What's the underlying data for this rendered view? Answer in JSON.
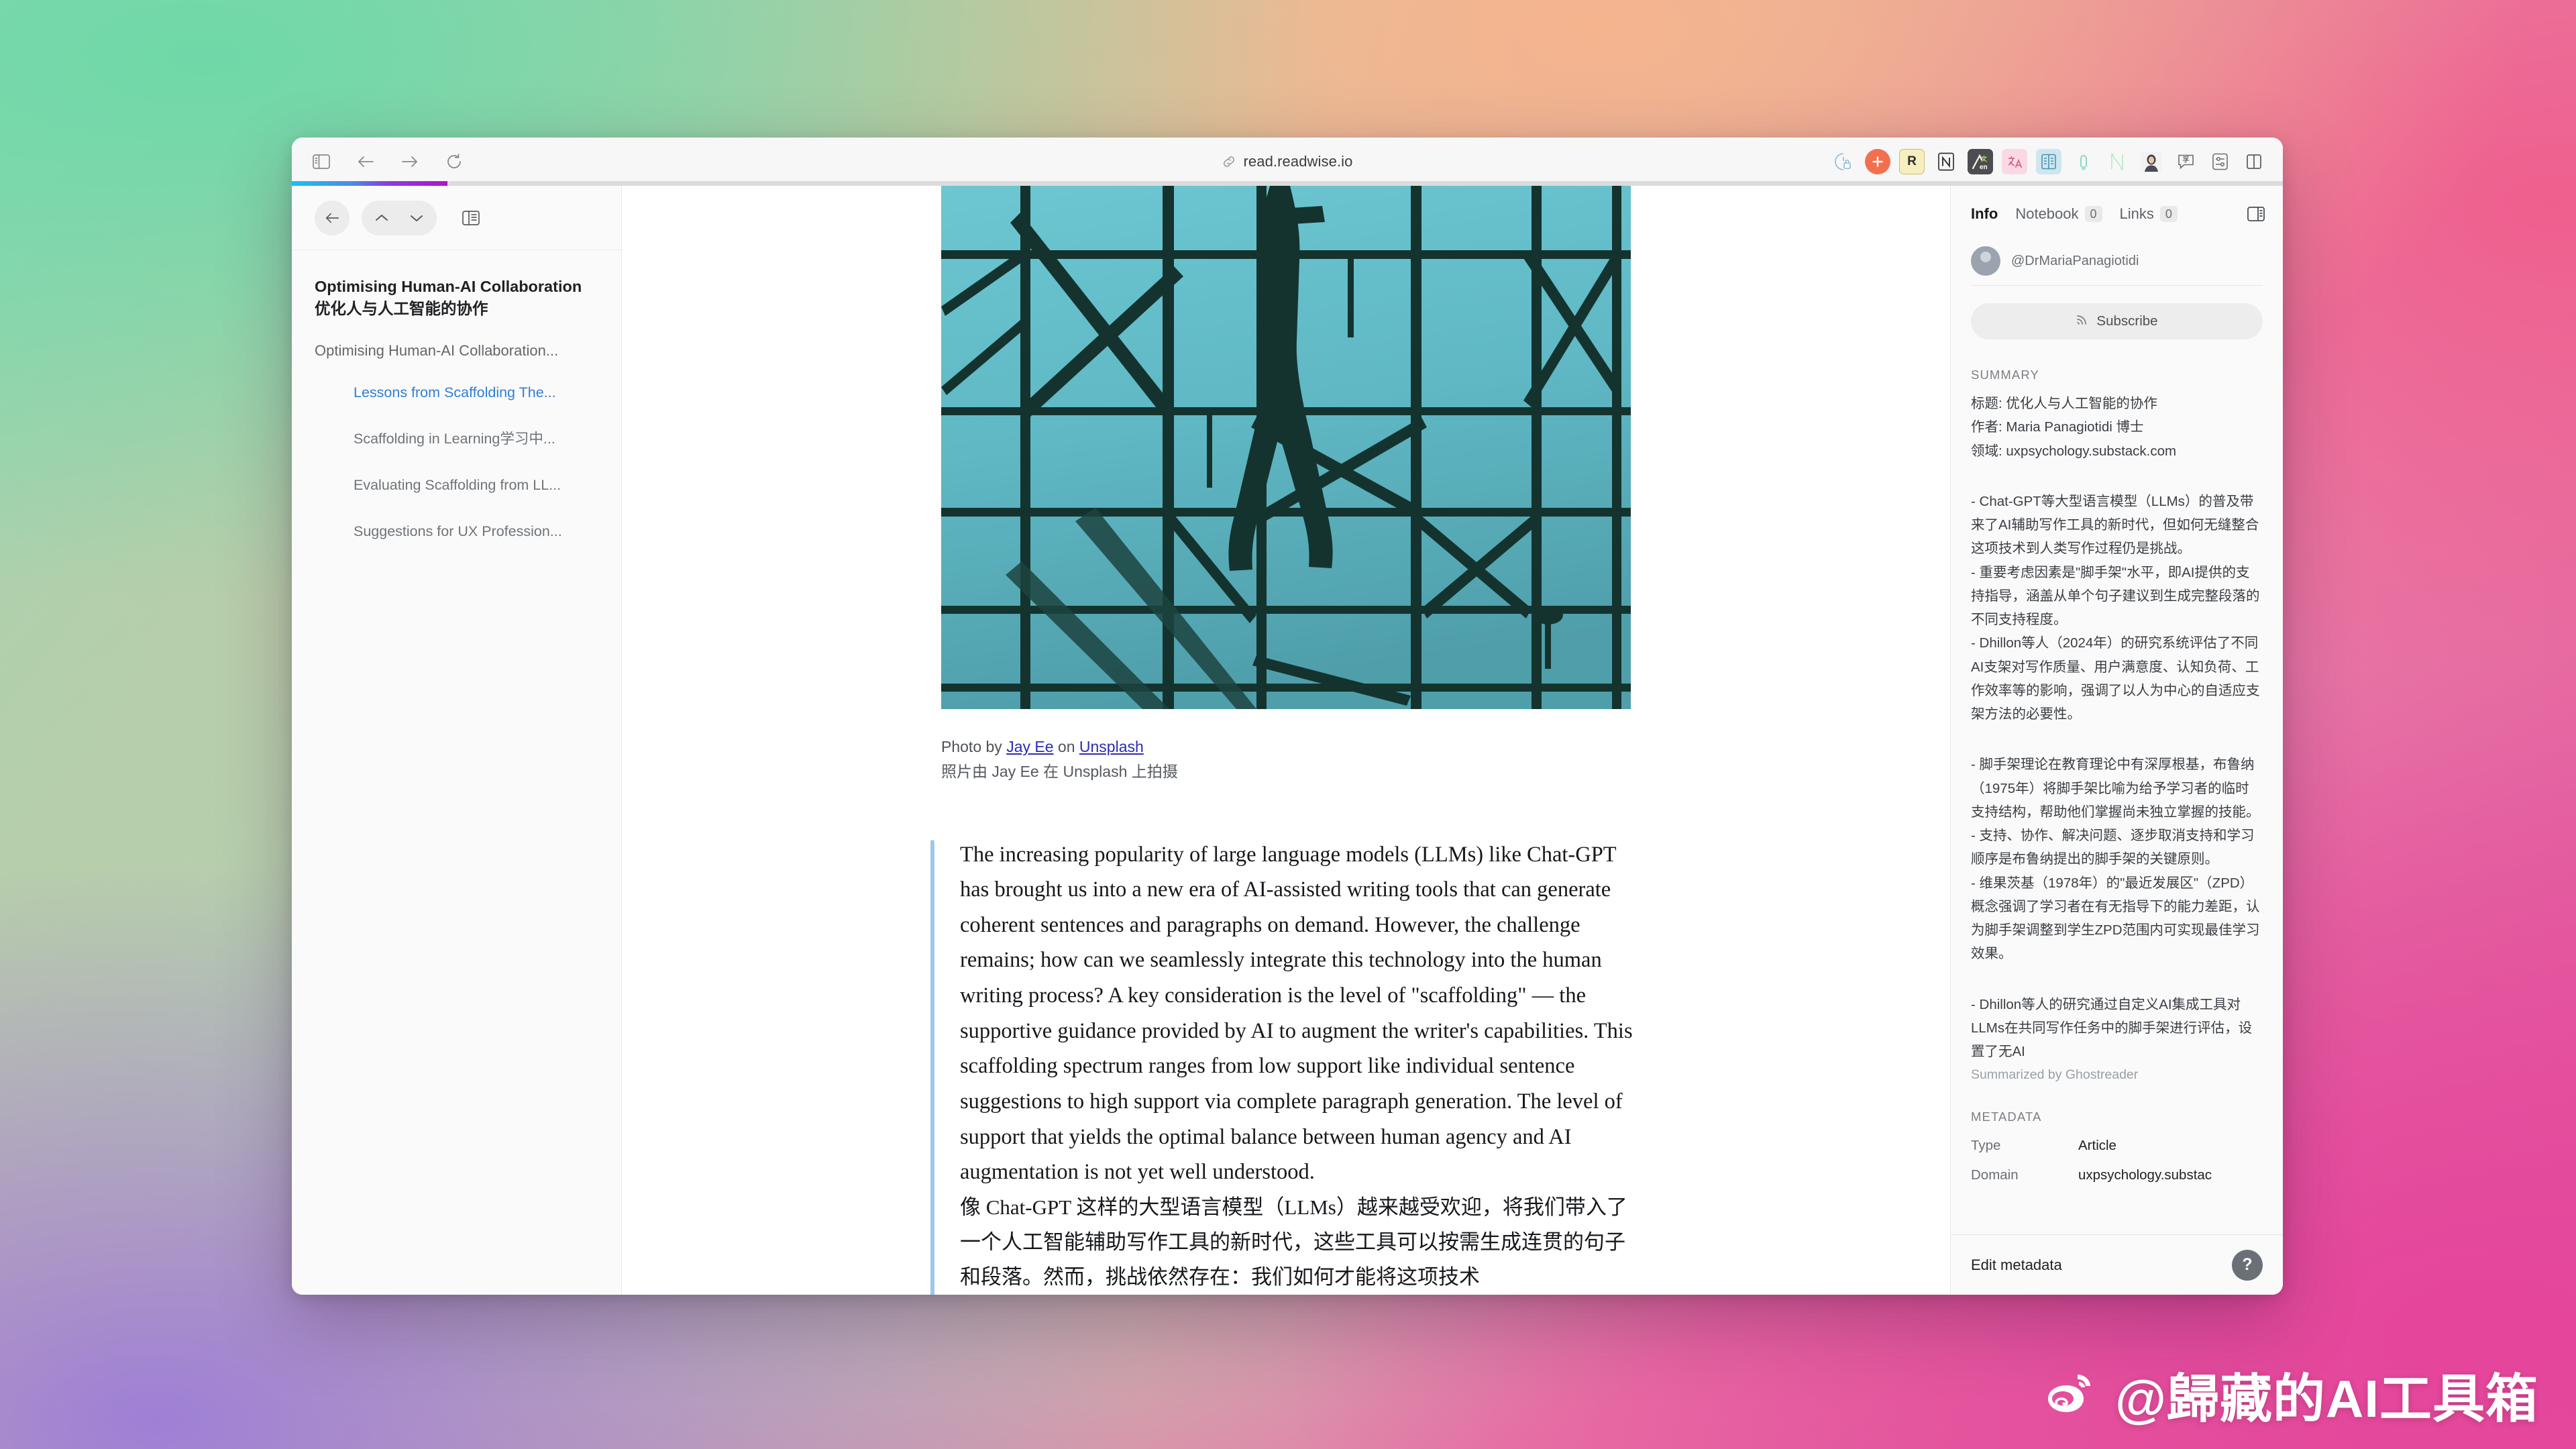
{
  "browser": {
    "url": "read.readwise.io",
    "nav": {
      "sidebar_toggle": "sidebar-panel",
      "back": "back",
      "forward": "forward",
      "reload": "reload"
    },
    "extensions": [
      {
        "name": "tab-lock-icon",
        "label": ""
      },
      {
        "name": "orange-plus-icon",
        "label": "+"
      },
      {
        "name": "readwise-icon",
        "label": "R"
      },
      {
        "name": "notion-icon",
        "label": "N"
      },
      {
        "name": "immersive-translate-icon",
        "label": ""
      },
      {
        "name": "pink-translate-icon",
        "label": "中"
      },
      {
        "name": "blue-dictionary-icon",
        "label": ""
      },
      {
        "name": "grammar-check-icon",
        "label": ""
      },
      {
        "name": "green-n-icon",
        "label": "N"
      },
      {
        "name": "avatar-extension-icon",
        "label": ""
      },
      {
        "name": "comment-translate-icon",
        "label": ""
      },
      {
        "name": "settings-sliders-icon",
        "label": ""
      },
      {
        "name": "split-view-icon",
        "label": ""
      }
    ],
    "progress_percent": 8
  },
  "sidebar": {
    "toolbar": {
      "back": "back-arrow",
      "prev": "chevron-up",
      "next": "chevron-down",
      "outline": "outline-panel"
    },
    "doc_title_en": "Optimising Human-AI Collaboration",
    "doc_title_cn": "优化人与人工智能的协作",
    "root_item": "Optimising Human-AI Collaboration...",
    "items": [
      {
        "label": "Lessons from Scaffolding The...",
        "active": true
      },
      {
        "label": "Scaffolding in Learning学习中...",
        "active": false
      },
      {
        "label": "Evaluating Scaffolding from LL...",
        "active": false
      },
      {
        "label": "Suggestions for UX Profession...",
        "active": false
      }
    ]
  },
  "article": {
    "image_alt": "scaffolding-photo",
    "credit_en_prefix": "Photo by ",
    "credit_author": "Jay Ee",
    "credit_mid": " on ",
    "credit_source": "Unsplash",
    "credit_cn": "照片由 Jay Ee 在 Unsplash 上拍摄",
    "paragraph_en": "The increasing popularity of large language models (LLMs) like Chat-GPT has brought us into a new era of AI-assisted writing tools that can generate coherent sentences and paragraphs on demand. However, the challenge remains; how can we seamlessly integrate this technology into the human writing process? A key consideration is the level of \"scaffolding\" — the supportive guidance provided by AI to augment the writer's capabilities. This scaffolding spectrum ranges from low support like individual sentence suggestions to high support via complete paragraph generation. The level of support that yields the optimal balance between human agency and AI augmentation is not yet well understood.",
    "paragraph_cn": "像 Chat-GPT 这样的大型语言模型（LLMs）越来越受欢迎，将我们带入了一个人工智能辅助写作工具的新时代，这些工具可以按需生成连贯的句子和段落。然而，挑战依然存在：我们如何才能将这项技术"
  },
  "info_panel": {
    "tabs": [
      {
        "label": "Info",
        "count": null,
        "active": true
      },
      {
        "label": "Notebook",
        "count": "0",
        "active": false
      },
      {
        "label": "Links",
        "count": "0",
        "active": false
      }
    ],
    "panel_toggle_icon": "right-panel-icon",
    "author_handle": "@DrMariaPanagiotidi",
    "subscribe_label": "Subscribe",
    "summary_label": "SUMMARY",
    "summary_head": [
      "标题: 优化人与人工智能的协作",
      "作者: Maria Panagiotidi 博士",
      "领域: uxpsychology.substack.com"
    ],
    "summary_bullets_1": [
      "- Chat-GPT等大型语言模型（LLMs）的普及带来了AI辅助写作工具的新时代，但如何无缝整合这项技术到人类写作过程仍是挑战。",
      "- 重要考虑因素是\"脚手架\"水平，即AI提供的支持指导，涵盖从单个句子建议到生成完整段落的不同支持程度。",
      "- Dhillon等人（2024年）的研究系统评估了不同AI支架对写作质量、用户满意度、认知负荷、工作效率等的影响，强调了以人为中心的自适应支架方法的必要性。"
    ],
    "summary_bullets_2": [
      "- 脚手架理论在教育理论中有深厚根基，布鲁纳（1975年）将脚手架比喻为给予学习者的临时支持结构，帮助他们掌握尚未独立掌握的技能。",
      "- 支持、协作、解决问题、逐步取消支持和学习顺序是布鲁纳提出的脚手架的关键原则。",
      "- 维果茨基（1978年）的\"最近发展区\"（ZPD）概念强调了学习者在有无指导下的能力差距，认为脚手架调整到学生ZPD范围内可实现最佳学习效果。"
    ],
    "summary_bullets_3": [
      "- Dhillon等人的研究通过自定义AI集成工具对LLMs在共同写作任务中的脚手架进行评估，设置了无AI"
    ],
    "summarized_by": "Summarized by Ghostreader",
    "metadata_label": "METADATA",
    "metadata": [
      {
        "key": "Type",
        "value": "Article"
      },
      {
        "key": "Domain",
        "value": "uxpsychology.substac"
      }
    ],
    "edit_metadata_label": "Edit metadata",
    "help_label": "?"
  },
  "watermark": {
    "icon": "weibo-logo",
    "text": "@歸藏的AI工具箱"
  },
  "colors": {
    "accent_blue": "#2f7fd4",
    "link": "#2b2bb5",
    "readbar": "#9ec8e8",
    "progress_start": "#17c3f0",
    "progress_end": "#b213c9"
  }
}
